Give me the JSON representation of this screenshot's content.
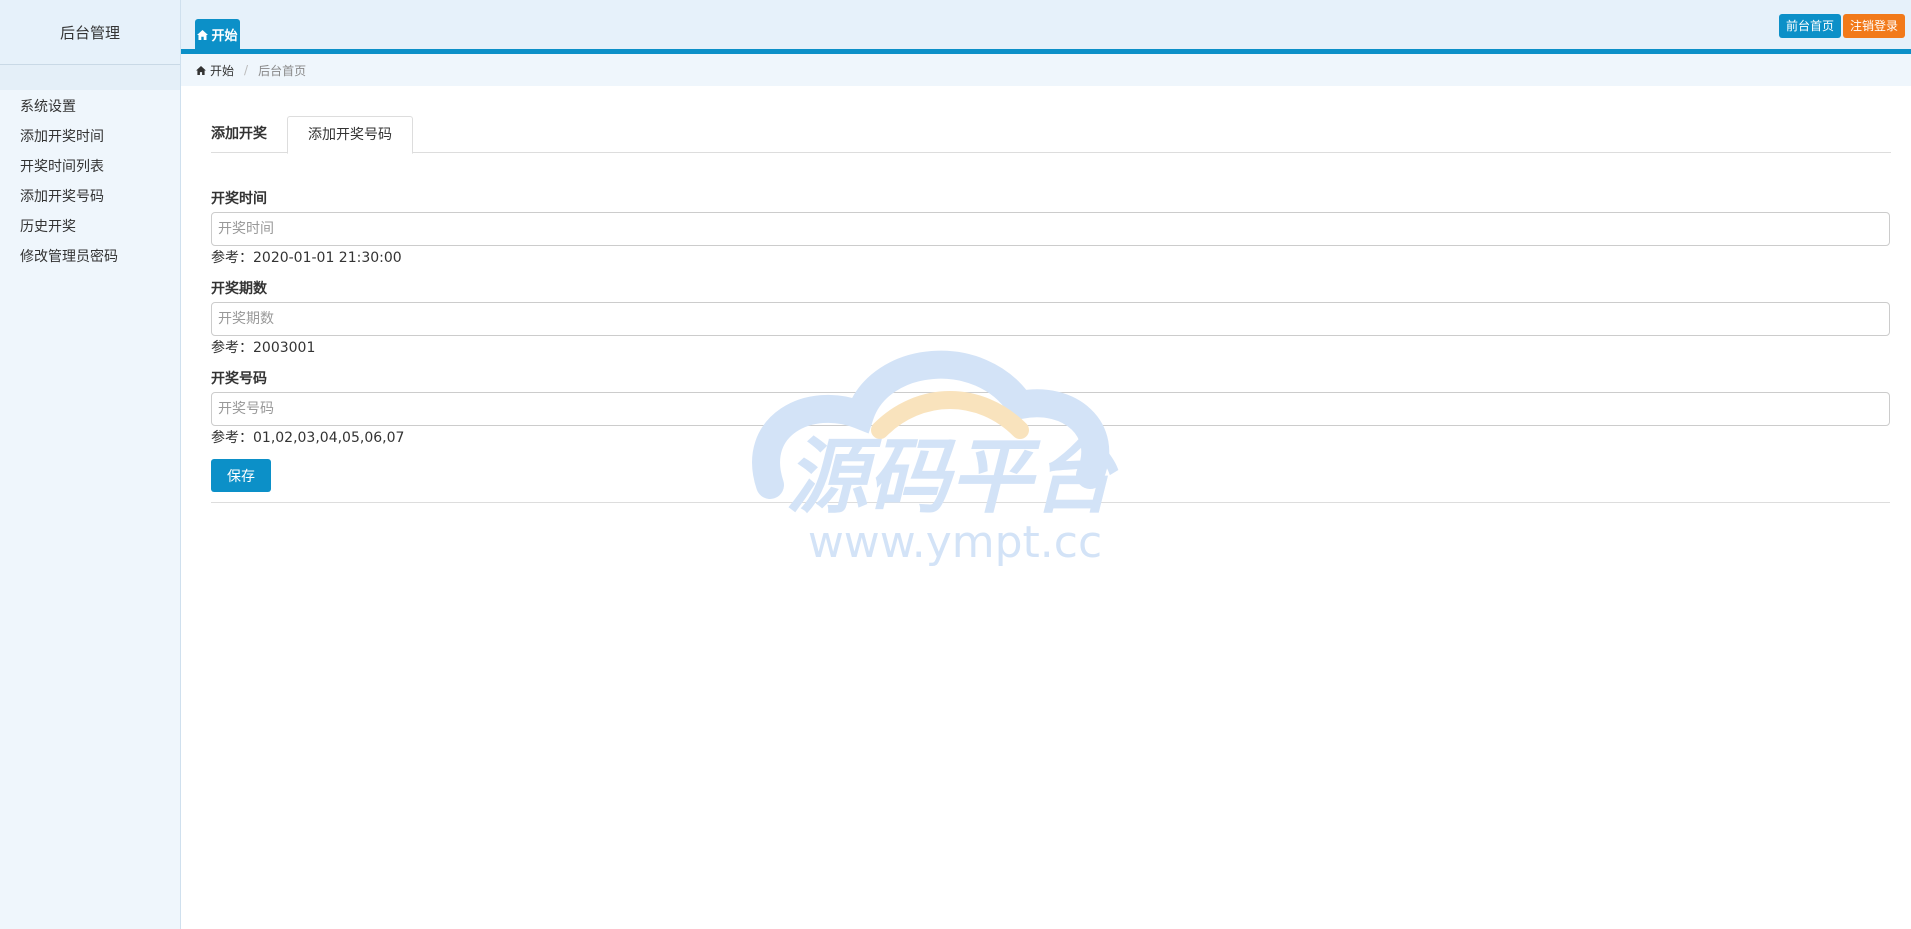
{
  "sidebar": {
    "title": "后台管理",
    "items": [
      {
        "label": "系统设置"
      },
      {
        "label": "添加开奖时间"
      },
      {
        "label": "开奖时间列表"
      },
      {
        "label": "添加开奖号码"
      },
      {
        "label": "历史开奖"
      },
      {
        "label": "修改管理员密码"
      }
    ]
  },
  "topbar": {
    "tab_label": "开始",
    "tab_icon": "home-icon",
    "front_home_label": "前台首页",
    "logout_label": "注销登录",
    "colors": {
      "primary": "#0c90c8",
      "logout": "#f27a1a"
    }
  },
  "breadcrumb": {
    "home_label": "开始",
    "separator": "/",
    "current": "后台首页"
  },
  "tabs": {
    "add_draw": "添加开奖",
    "add_number": "添加开奖号码"
  },
  "form": {
    "draw_time": {
      "label": "开奖时间",
      "value": "",
      "placeholder": "开奖时间",
      "hint": "参考：2020-01-01 21:30:00"
    },
    "draw_period": {
      "label": "开奖期数",
      "value": "",
      "placeholder": "开奖期数",
      "hint": "参考：2003001"
    },
    "draw_number": {
      "label": "开奖号码",
      "value": "",
      "placeholder": "开奖号码",
      "hint": "参考：01,02,03,04,05,06,07"
    },
    "save_label": "保存"
  },
  "watermark": {
    "title": "源码平台",
    "url": "www.ympt.cc"
  }
}
